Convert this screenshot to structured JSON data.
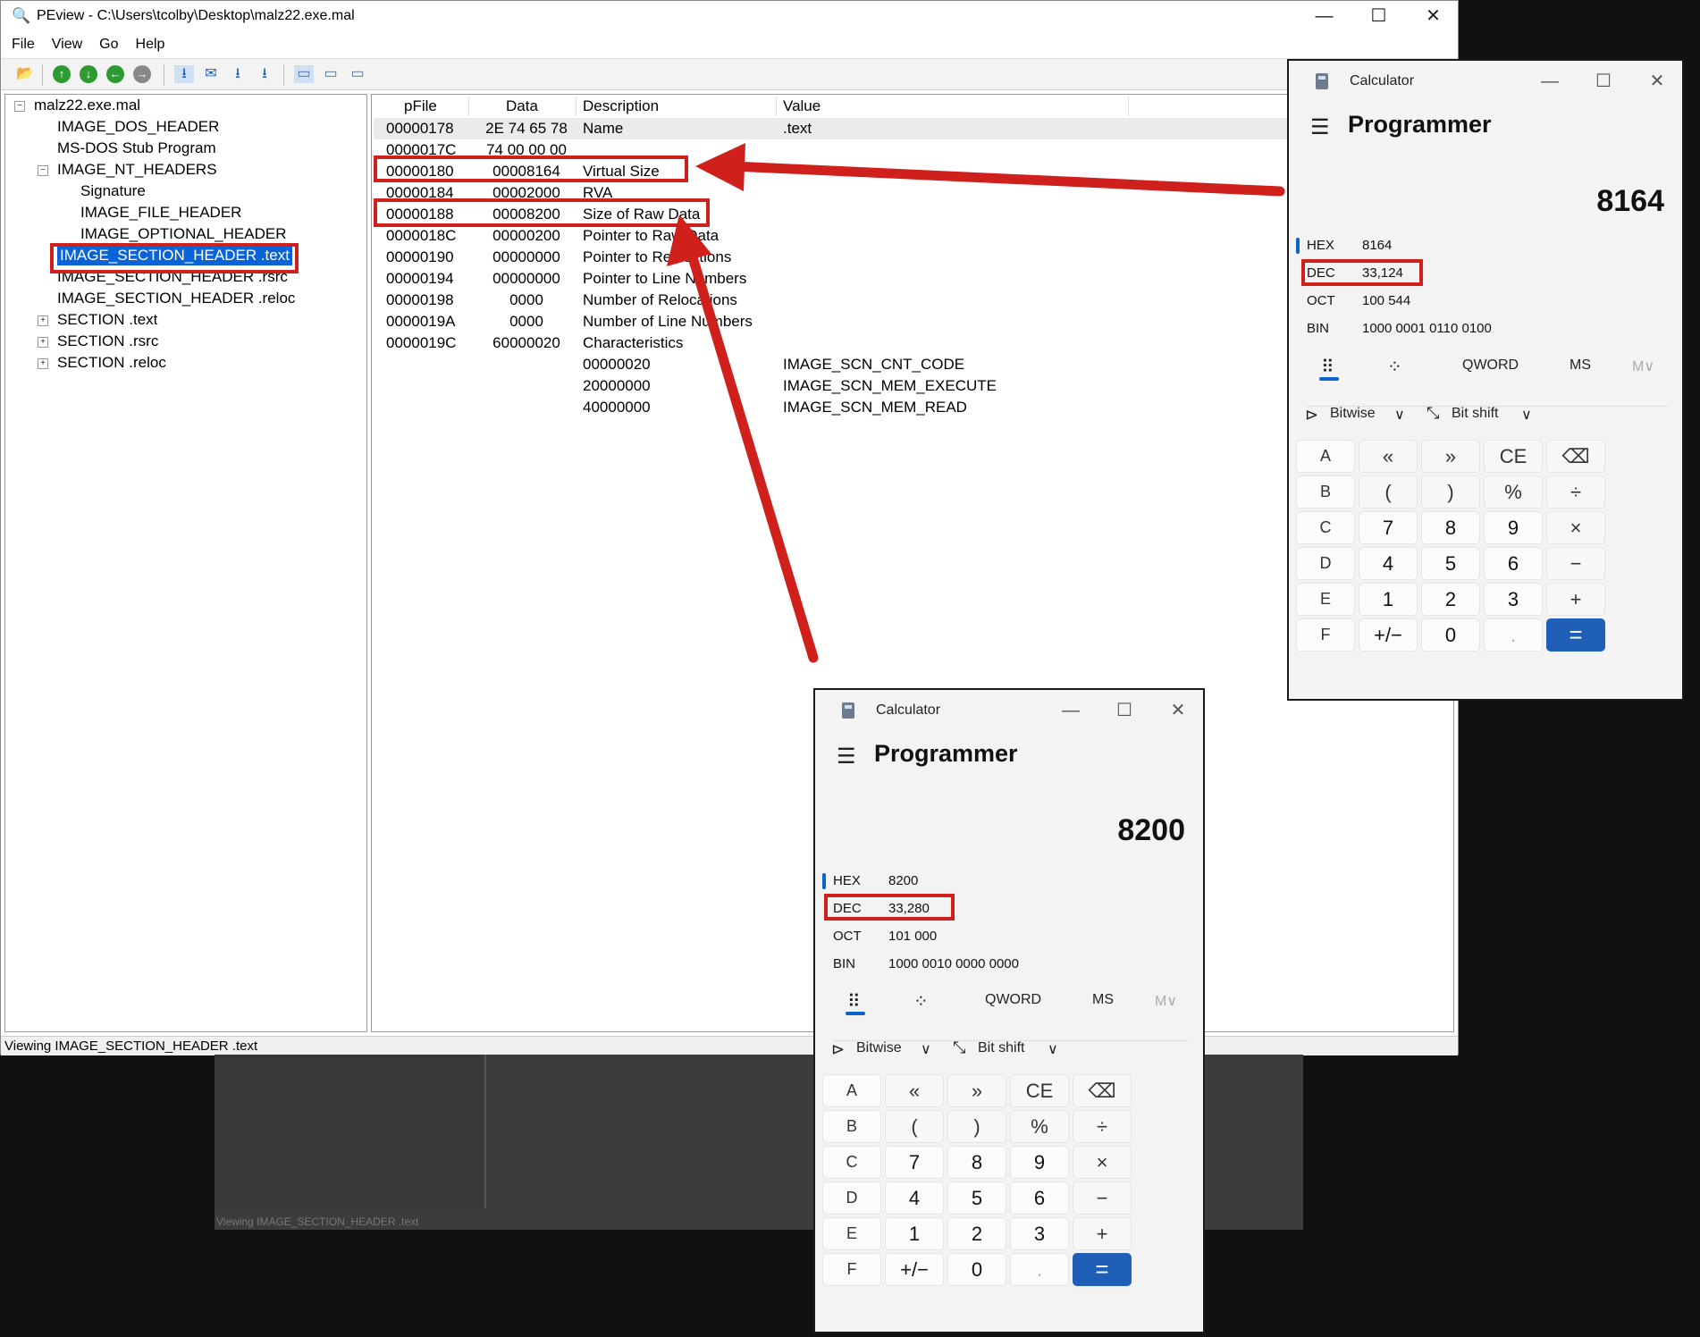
{
  "peview": {
    "title": "PEview - C:\\Users\\tcolby\\Desktop\\malz22.exe.mal",
    "controls": {
      "minimize": "—",
      "maximize": "☐",
      "close": "✕"
    },
    "menu": [
      "File",
      "View",
      "Go",
      "Help"
    ],
    "tree": [
      {
        "label": "malz22.exe.mal",
        "expander": "−"
      },
      {
        "label": "IMAGE_DOS_HEADER"
      },
      {
        "label": "MS-DOS Stub Program"
      },
      {
        "label": "IMAGE_NT_HEADERS",
        "expander": "−"
      },
      {
        "label": "Signature"
      },
      {
        "label": "IMAGE_FILE_HEADER"
      },
      {
        "label": "IMAGE_OPTIONAL_HEADER"
      },
      {
        "label": "IMAGE_SECTION_HEADER .text",
        "selected": true
      },
      {
        "label": "IMAGE_SECTION_HEADER .rsrc"
      },
      {
        "label": "IMAGE_SECTION_HEADER .reloc"
      },
      {
        "label": "SECTION .text",
        "expander": "+"
      },
      {
        "label": "SECTION .rsrc",
        "expander": "+"
      },
      {
        "label": "SECTION .reloc",
        "expander": "+"
      }
    ],
    "columns": {
      "pfile": "pFile",
      "data": "Data",
      "description": "Description",
      "value": "Value"
    },
    "rows": [
      {
        "pfile": "00000178",
        "data": "2E  74  65  78",
        "description": "Name",
        "value": ".text"
      },
      {
        "pfile": "0000017C",
        "data": "74  00  00  00",
        "description": "",
        "value": ""
      },
      {
        "pfile": "00000180",
        "data": "00008164",
        "description": "Virtual Size",
        "value": ""
      },
      {
        "pfile": "00000184",
        "data": "00002000",
        "description": "RVA",
        "value": ""
      },
      {
        "pfile": "00000188",
        "data": "00008200",
        "description": "Size of Raw Data",
        "value": ""
      },
      {
        "pfile": "0000018C",
        "data": "00000200",
        "description": "Pointer to Raw Data",
        "value": ""
      },
      {
        "pfile": "00000190",
        "data": "00000000",
        "description": "Pointer to Relocations",
        "value": ""
      },
      {
        "pfile": "00000194",
        "data": "00000000",
        "description": "Pointer to Line Numbers",
        "value": ""
      },
      {
        "pfile": "00000198",
        "data": "0000",
        "description": "Number of Relocations",
        "value": ""
      },
      {
        "pfile": "0000019A",
        "data": "0000",
        "description": "Number of Line Numbers",
        "value": ""
      },
      {
        "pfile": "0000019C",
        "data": "60000020",
        "description": "Characteristics",
        "value": ""
      },
      {
        "pfile": "",
        "data": "",
        "description": "00000020",
        "value": "IMAGE_SCN_CNT_CODE"
      },
      {
        "pfile": "",
        "data": "",
        "description": "20000000",
        "value": "IMAGE_SCN_MEM_EXECUTE"
      },
      {
        "pfile": "",
        "data": "",
        "description": "40000000",
        "value": "IMAGE_SCN_MEM_READ"
      }
    ],
    "status": "Viewing IMAGE_SECTION_HEADER .text",
    "ghost_status": "Viewing IMAGE_SECTION_HEADER .text"
  },
  "calc_top": {
    "title": "Calculator",
    "mode": "Programmer",
    "display": "8164",
    "hex": "8164",
    "dec": "33,124",
    "oct": "100 544",
    "bin": "1000 0001 0110 0100"
  },
  "calc_bottom": {
    "title": "Calculator",
    "mode": "Programmer",
    "display": "8200",
    "hex": "8200",
    "dec": "33,280",
    "oct": "101 000",
    "bin": "1000 0010 0000 0000"
  },
  "calc_labels": {
    "hex": "HEX",
    "dec": "DEC",
    "oct": "OCT",
    "bin": "BIN",
    "qword": "QWORD",
    "ms": "MS",
    "mv": "M∨",
    "bitwise": "Bitwise",
    "bitshift": "Bit shift",
    "menu_icon": "☰",
    "keypad_icon": "⠿",
    "bitflip_icon": "⁘",
    "chevron": "∨",
    "keys": [
      [
        "A",
        "«",
        "»",
        "CE",
        "⌫"
      ],
      [
        "B",
        "(",
        ")",
        "%",
        "÷"
      ],
      [
        "C",
        "7",
        "8",
        "9",
        "×"
      ],
      [
        "D",
        "4",
        "5",
        "6",
        "−"
      ],
      [
        "E",
        "1",
        "2",
        "3",
        "+"
      ],
      [
        "F",
        "+/−",
        "0",
        ".",
        "="
      ]
    ]
  },
  "colors": {
    "annotation": "#d0201c",
    "selection": "#0a64d8",
    "accent": "#1f5fb8"
  }
}
